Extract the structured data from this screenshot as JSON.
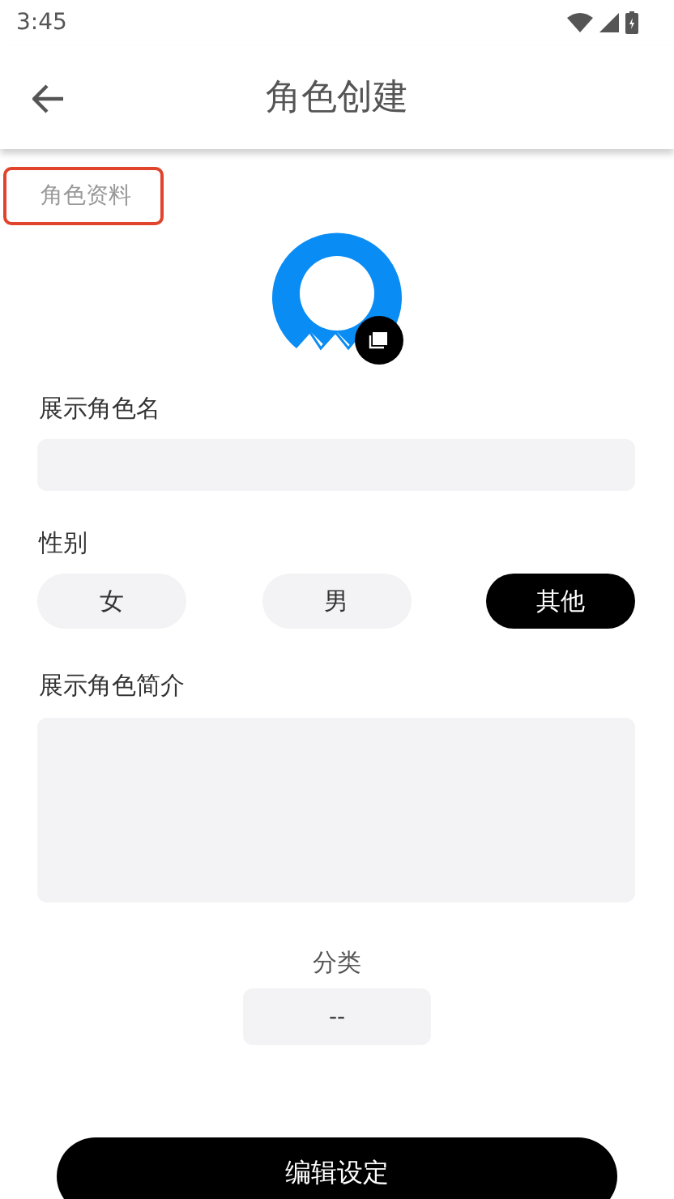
{
  "status_bar": {
    "time": "3:45"
  },
  "header": {
    "title": "角色创建"
  },
  "section": {
    "label": "角色资料",
    "highlighted": true
  },
  "name_field": {
    "label": "展示角色名"
  },
  "gender": {
    "label": "性别",
    "options": [
      {
        "label": "女",
        "selected": false
      },
      {
        "label": "男",
        "selected": false
      },
      {
        "label": "其他",
        "selected": true
      }
    ]
  },
  "intro_field": {
    "label": "展示角色简介"
  },
  "category": {
    "label": "分类",
    "value": "--"
  },
  "primary_button": {
    "label": "编辑设定"
  }
}
